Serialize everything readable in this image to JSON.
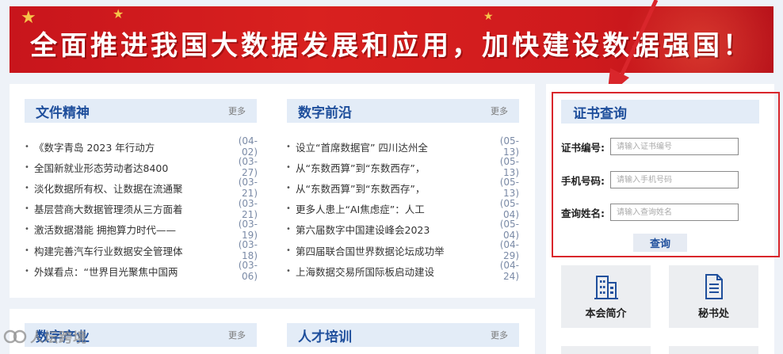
{
  "banner": {
    "title": "全面推进我国大数据发展和应用，加快建设数据强国！"
  },
  "sections": {
    "wenjian": {
      "title": "文件精神",
      "more": "更多",
      "items": [
        {
          "title": "《数字青岛 2023 年行动方",
          "date": "(04-02)"
        },
        {
          "title": "全国新就业形态劳动者达8400",
          "date": "(03-27)"
        },
        {
          "title": "淡化数据所有权、让数据在流通聚",
          "date": "(03-21)"
        },
        {
          "title": "基层营商大数据管理须从三方面着",
          "date": "(03-21)"
        },
        {
          "title": "激活数据潜能 拥抱算力时代——",
          "date": "(03-19)"
        },
        {
          "title": "构建完善汽车行业数据安全管理体",
          "date": "(03-18)"
        },
        {
          "title": "外媒看点：“世界目光聚焦中国两",
          "date": "(03-06)"
        }
      ]
    },
    "shuzi": {
      "title": "数字前沿",
      "more": "更多",
      "items": [
        {
          "title": "设立“首席数据官” 四川达州全",
          "date": "(05-13)"
        },
        {
          "title": "从“东数西算”到“东数西存”，",
          "date": "(05-13)"
        },
        {
          "title": "从“东数西算”到“东数西存”，",
          "date": "(05-13)"
        },
        {
          "title": "更多人患上“AI焦虑症”：人工",
          "date": "(05-04)"
        },
        {
          "title": "第六届数字中国建设峰会2023",
          "date": "(05-04)"
        },
        {
          "title": "第四届联合国世界数据论坛成功举",
          "date": "(04-29)"
        },
        {
          "title": "上海数据交易所国际板启动建设",
          "date": "(04-24)"
        }
      ]
    },
    "chanye": {
      "title": "数字产业",
      "more": "更多"
    },
    "rencai": {
      "title": "人才培训",
      "more": "更多"
    }
  },
  "cert": {
    "title": "证书查询",
    "fields": [
      {
        "label": "证书编号:",
        "placeholder": "请输入证书编号"
      },
      {
        "label": "手机号码:",
        "placeholder": "请输入手机号码"
      },
      {
        "label": "查询姓名:",
        "placeholder": "请输入查询姓名"
      }
    ],
    "button": "查询"
  },
  "tiles": [
    {
      "label": "本会简介",
      "icon": "building-icon"
    },
    {
      "label": "秘书处",
      "icon": "document-icon"
    }
  ],
  "watermark": "人坛跨境",
  "colors": {
    "banner_red": "#d9211f",
    "accent_blue": "#1f4f9c",
    "highlight_red": "#d9262b",
    "section_head_bg": "#e3ecf7"
  }
}
